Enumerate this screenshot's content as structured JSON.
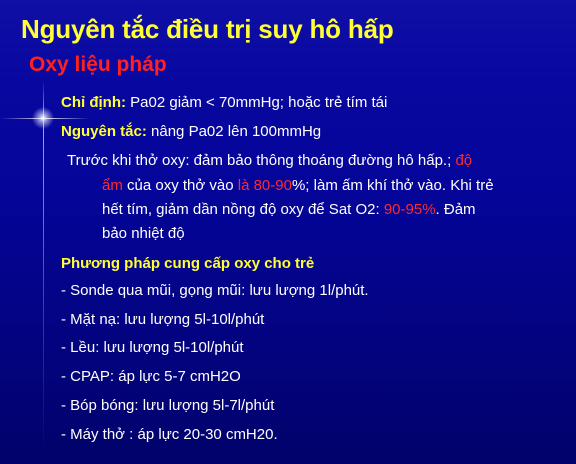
{
  "title": "Nguyên tắc điều trị suy hô hấp",
  "subtitle": "Oxy liệu pháp",
  "indication": {
    "label": "Chỉ định:",
    "text": " Pa02 giảm < 70mmHg; hoặc trẻ tím tái"
  },
  "principle": {
    "label": "Nguyên tắc:",
    "text": " nâng Pa02 lên 100mmHg"
  },
  "para": {
    "l1a": "Trước khi thở oxy: đảm bảo thông thoáng đường hô hấp.; ",
    "l1b": "độ",
    "l2a": "ẩm",
    "l2b": " của oxy thở vào ",
    "l2c": "là 80-90",
    "l2d": "%; làm ấm khí thở vào. Khi trẻ",
    "l3a": "hết tím, giảm dần nồng độ oxy để Sat O2: ",
    "l3b": "90-95%",
    "l3c": ". Đảm",
    "l4": "bảo nhiệt độ"
  },
  "methods_heading": "Phương pháp cung cấp oxy cho trẻ",
  "methods": [
    "- Sonde qua mũi, gọng mũi:  lưu lượng 1l/phút.",
    "- Mặt nạ: lưu lượng 5l-10l/phút",
    "- Lều: lưu lượng 5l-10l/phút",
    "- CPAP: áp lực 5-7 cmH2O",
    "- Bóp bóng: lưu lượng 5l-7l/phút",
    "- Máy thở : áp lực 20-30 cmH20."
  ],
  "colors": {
    "title": "#ffff33",
    "subtitle": "#ff2020",
    "background": "#05059a",
    "highlight": "#ff2a2a"
  }
}
